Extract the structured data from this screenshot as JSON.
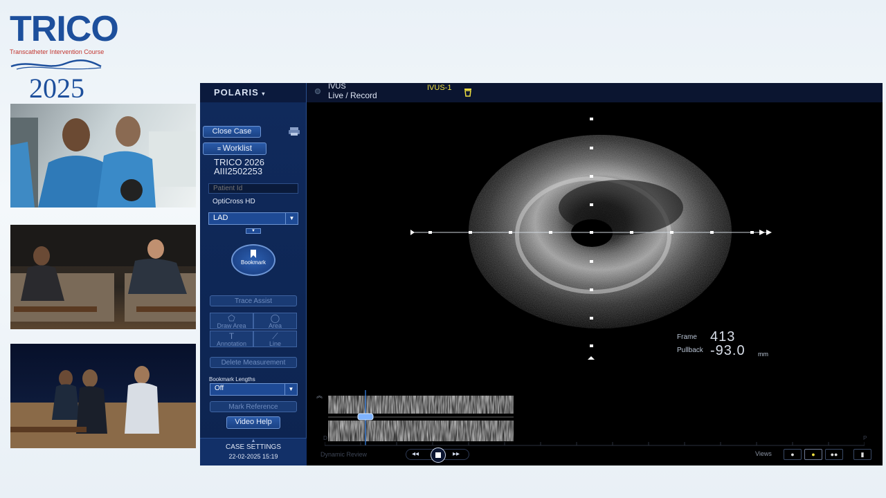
{
  "logo": {
    "word": "TRICO",
    "tagline": "Transcatheter Intervention Course",
    "year": "2025"
  },
  "app": {
    "brand": "POLARIS",
    "mode_title": "IVUS",
    "mode_subtitle": "Live / Record",
    "run_label": "IVUS-1"
  },
  "sidebar": {
    "close_case": "Close Case",
    "worklist": "Worklist",
    "case_name_line1": "TRICO 2026",
    "case_name_line2": "AIII2502253",
    "patient_placeholder": "Patient Id",
    "catheter": "OptiCross HD",
    "vessel": "LAD",
    "bookmark": "Bookmark",
    "trace_assist": "Trace Assist",
    "draw_area": "Draw Area",
    "area": "Area",
    "annotation": "Annotation",
    "line": "Line",
    "delete_measurement": "Delete Measurement",
    "bookmark_lengths_label": "Bookmark Lengths",
    "bookmark_lengths_value": "Off",
    "mark_reference": "Mark Reference",
    "video_help": "Video Help",
    "case_settings": "CASE SETTINGS",
    "datetime": "22-02-2025 15:19"
  },
  "readout": {
    "frame_label": "Frame",
    "frame_value": "413",
    "pullback_label": "Pullback",
    "pullback_value": "-93.0",
    "pullback_unit": "mm"
  },
  "longview": {
    "left_marker": "D",
    "right_marker": "P",
    "mode": "Dynamic Review",
    "views_label": "Views"
  },
  "colors": {
    "accent": "#1e4a95",
    "run_label": "#f0e040"
  }
}
